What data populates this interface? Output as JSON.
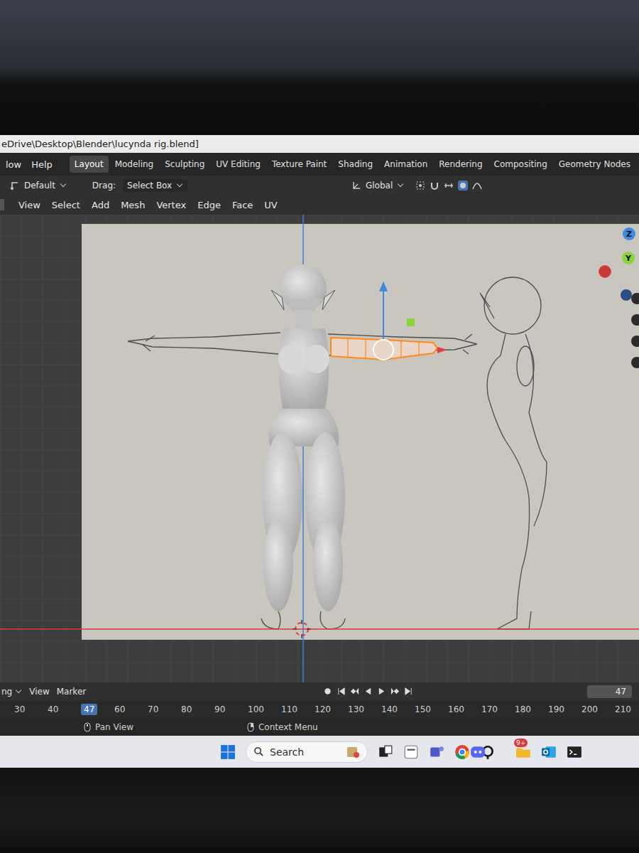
{
  "window": {
    "title": "eDrive\\Desktop\\Blender\\lucynda rig.blend]"
  },
  "menu": [
    "low",
    "Help"
  ],
  "workspaces": [
    {
      "label": "Layout",
      "selected": true
    },
    {
      "label": "Modeling",
      "selected": false
    },
    {
      "label": "Sculpting",
      "selected": false
    },
    {
      "label": "UV Editing",
      "selected": false
    },
    {
      "label": "Texture Paint",
      "selected": false
    },
    {
      "label": "Shading",
      "selected": false
    },
    {
      "label": "Animation",
      "selected": false
    },
    {
      "label": "Rendering",
      "selected": false
    },
    {
      "label": "Compositing",
      "selected": false
    },
    {
      "label": "Geometry Nodes",
      "selected": false
    }
  ],
  "tool_header": {
    "mode": "Default",
    "drag_label": "Drag:",
    "drag_value": "Select Box",
    "orientation": "Global"
  },
  "viewport_menu": [
    "View",
    "Select",
    "Add",
    "Mesh",
    "Vertex",
    "Edge",
    "Face",
    "UV"
  ],
  "viewport": {
    "arm_selected": true
  },
  "gizmo": [
    {
      "label": "Z",
      "color": "#3d8be0"
    },
    {
      "label": "Y",
      "color": "#8bd43d"
    }
  ],
  "timeline": {
    "menu": [
      "ng",
      "View",
      "Marker"
    ],
    "current_frame": "47",
    "ticks": [
      {
        "label": "30",
        "selected": false
      },
      {
        "label": "40",
        "selected": false
      },
      {
        "label": "47",
        "selected": true
      },
      {
        "label": "60",
        "selected": false
      },
      {
        "label": "70",
        "selected": false
      },
      {
        "label": "80",
        "selected": false
      },
      {
        "label": "90",
        "selected": false
      },
      {
        "label": "100",
        "selected": false
      },
      {
        "label": "110",
        "selected": false
      },
      {
        "label": "120",
        "selected": false
      },
      {
        "label": "130",
        "selected": false
      },
      {
        "label": "140",
        "selected": false
      },
      {
        "label": "150",
        "selected": false
      },
      {
        "label": "160",
        "selected": false
      },
      {
        "label": "170",
        "selected": false
      },
      {
        "label": "180",
        "selected": false
      },
      {
        "label": "190",
        "selected": false
      },
      {
        "label": "200",
        "selected": false
      },
      {
        "label": "210",
        "selected": false
      }
    ]
  },
  "status_bar": [
    "Pan View",
    "Context Menu"
  ],
  "taskbar": {
    "search": "Search",
    "badge": "9+"
  }
}
